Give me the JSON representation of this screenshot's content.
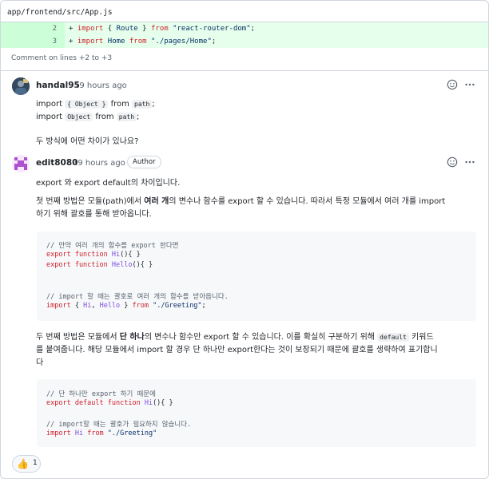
{
  "file": {
    "path": "app/frontend/src/App.js"
  },
  "diff": {
    "lines": [
      {
        "num": "2",
        "sign": "+",
        "kw": "import",
        "mid": " { ",
        "name": "Route",
        "end": " } ",
        "from": "from",
        "str": "\"react-router-dom\"",
        "tail": ";"
      },
      {
        "num": "3",
        "sign": "+",
        "kw": "import",
        "mid": " ",
        "name": "Home",
        "end": " ",
        "from": "from",
        "str": "\"./pages/Home\"",
        "tail": ";"
      }
    ]
  },
  "thread": {
    "comment_on": "Comment on lines +2 to +3"
  },
  "comment1": {
    "author": "handal95",
    "time": "19 hours ago",
    "line1": {
      "a": "import",
      "code1": "{ Object }",
      "b": "from",
      "code2": "path",
      "c": ";"
    },
    "line2": {
      "a": "import",
      "code1": "Object",
      "b": "from",
      "code2": "path",
      "c": ";"
    },
    "question": "두 방식에 어떤 차이가 있나요?"
  },
  "comment2": {
    "author": "edit8080",
    "time": "19 hours ago",
    "badge": "Author",
    "intro": "export 와 export default의 차이입니다.",
    "p1": {
      "a": "첫 번째 방법은 모듈(path)에서 ",
      "bold": "여러 개",
      "b": "의 변수나 함수를 export 할 수 있습니다. 따라서 특정 모듈에서 여러 개를 import",
      "c": "하기 위해 괄호를 통해 받아옵니다."
    },
    "code1": {
      "c1": "// 만약 여러 개의 함수를 export 한다면",
      "l2a": "export function",
      "l2b": " Hi",
      "l2c": "(){ }",
      "l3a": "export function",
      "l3b": " Hello",
      "l3c": "(){ }",
      "c4": "// import 할 때는 괄호로 여러 개의 함수를 받아옵니다.",
      "l5a": "import",
      "l5b": " { ",
      "l5c": "Hi",
      "l5d": ", ",
      "l5e": "Hello",
      "l5f": " } ",
      "l5g": "from",
      "l5h": " \"./Greeting\"",
      "l5i": ";"
    },
    "p2": {
      "a": "두 번째 방법은 모듈에서 ",
      "bold": "단 하나",
      "b": "의 변수나 함수만 export 할 수 있습니다. 이를 확실히 구분하기 위해 ",
      "code": "default",
      "c": " 키워드",
      "d": "를 붙여줍니다. 해당 모듈에서 import 할 경우 단 하나만 export한다는 것이 보장되기 때문에 괄호를 생략하여 표기합니",
      "e": "다"
    },
    "code2": {
      "c1": "// 단 하나만 export 하기 때문에",
      "l2a": "export default function",
      "l2b": " Hi",
      "l2c": "(){ }",
      "c3": "// import할 때는 괄호가 필요하지 않습니다.",
      "l4a": "import",
      "l4b": " Hi ",
      "l4c": "from",
      "l4d": " \"./Greeting\""
    }
  },
  "reactions": {
    "emoji": "👍",
    "count": "1"
  },
  "icons": {
    "smiley": "smiley-icon",
    "more": "kebab-horizontal-icon",
    "thumbs": "thumbs-up-icon"
  },
  "colors": {
    "diff_add_bg": "#e6ffec",
    "diff_num_bg": "#ccffd8",
    "keyword": "#cf222e",
    "string": "#0a3069",
    "function": "#8250df"
  }
}
